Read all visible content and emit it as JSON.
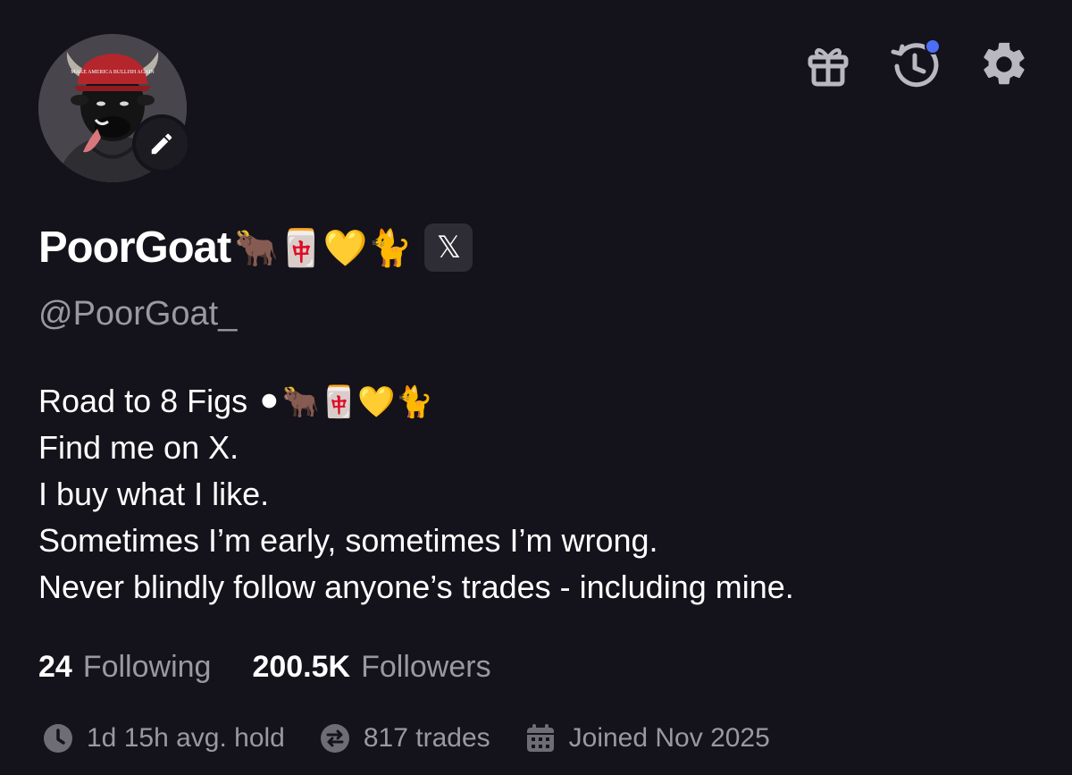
{
  "profile": {
    "display_name": "PoorGoat",
    "name_emojis": "🐂🀄💛🐈",
    "handle": "@PoorGoat_",
    "x_badge_label": "𝕏",
    "avatar_hat_text": "MAKE AMERICA BULLISH AGAIN"
  },
  "bio": {
    "line1_text": "Road to 8 Figs ",
    "line1_emojis": "⚫🐂🀄💛🐈",
    "line2": "Find me on X.",
    "line3": "I buy what I like.",
    "line4": "Sometimes I’m early, sometimes I’m wrong.",
    "line5": "Never blindly follow anyone’s trades - including mine."
  },
  "stats": {
    "following_count": "24",
    "following_label": "Following",
    "followers_count": "200.5K",
    "followers_label": "Followers"
  },
  "meta": {
    "avg_hold": "1d 15h avg. hold",
    "trades": "817 trades",
    "joined": "Joined Nov 2025"
  },
  "icons": {
    "top_bar": [
      "gift-icon",
      "history-icon",
      "settings-icon"
    ],
    "avatar": "edit-pencil-icon",
    "meta": [
      "clock-icon",
      "swap-icon",
      "calendar-icon"
    ]
  },
  "colors": {
    "background": "#14121a",
    "text_primary": "#ffffff",
    "text_secondary": "#9a99a1",
    "notification_dot": "#4b6ef5",
    "icon_gray": "#b9b8c0"
  }
}
